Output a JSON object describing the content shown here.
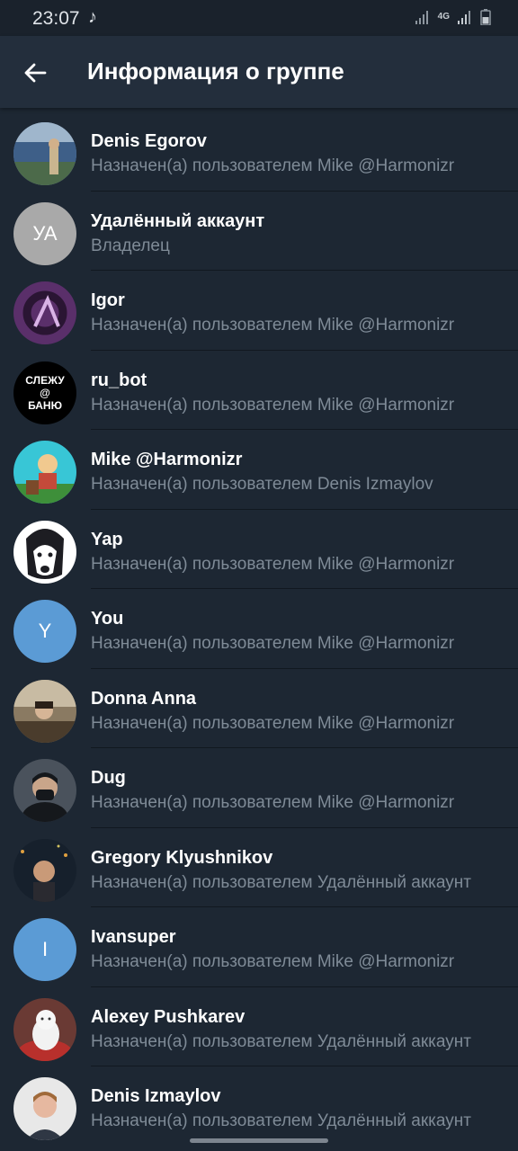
{
  "status": {
    "time": "23:07",
    "network": "4G",
    "icons": [
      "music-note-icon",
      "signal-icon",
      "4g-icon",
      "signal-icon",
      "battery-icon"
    ]
  },
  "header": {
    "title": "Информация о группе",
    "back_icon": "arrow-left-icon"
  },
  "colors": {
    "background": "#1d2733",
    "header": "#232e3c",
    "secondary_text": "#7f8b97"
  },
  "members": [
    {
      "name": "Denis Egorov",
      "subtitle": "Назначен(а) пользователем Mike @Harmonizr",
      "avatar": "photo"
    },
    {
      "name": "Удалённый аккаунт",
      "subtitle": "Владелец",
      "avatar": "initials",
      "initials": "УА",
      "color": "#a9a9a9"
    },
    {
      "name": "Igor",
      "subtitle": "Назначен(а) пользователем Mike @Harmonizr",
      "avatar": "logo"
    },
    {
      "name": "ru_bot",
      "subtitle": "Назначен(а) пользователем Mike @Harmonizr",
      "avatar": "text-logo",
      "avatar_text": [
        "СЛЕЖУ",
        "@",
        "БАНЮ"
      ]
    },
    {
      "name": "Mike @Harmonizr",
      "subtitle": "Назначен(а) пользователем Denis Izmaylov",
      "avatar": "photo"
    },
    {
      "name": "Yap",
      "subtitle": "Назначен(а) пользователем Mike @Harmonizr",
      "avatar": "photo"
    },
    {
      "name": "You",
      "subtitle": "Назначен(а) пользователем Mike @Harmonizr",
      "avatar": "initials",
      "initials": "Y",
      "color": "#5b9bd5"
    },
    {
      "name": "Donna Anna",
      "subtitle": "Назначен(а) пользователем Mike @Harmonizr",
      "avatar": "photo"
    },
    {
      "name": "Dug",
      "subtitle": "Назначен(а) пользователем Mike @Harmonizr",
      "avatar": "photo"
    },
    {
      "name": "Gregory Klyushnikov",
      "subtitle": "Назначен(а) пользователем Удалённый аккаунт",
      "avatar": "photo"
    },
    {
      "name": "Ivansuper",
      "subtitle": "Назначен(а) пользователем Mike @Harmonizr",
      "avatar": "initials",
      "initials": "I",
      "color": "#5b9bd5"
    },
    {
      "name": "Alexey Pushkarev",
      "subtitle": "Назначен(а) пользователем Удалённый аккаунт",
      "avatar": "photo"
    },
    {
      "name": "Denis Izmaylov",
      "subtitle": "Назначен(а) пользователем Удалённый аккаунт",
      "avatar": "photo"
    }
  ]
}
